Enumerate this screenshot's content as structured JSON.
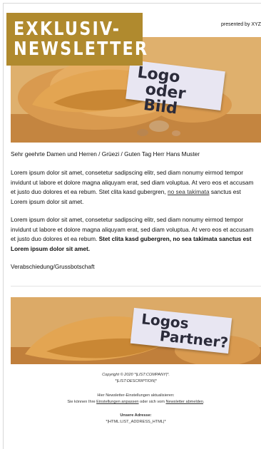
{
  "badge": {
    "line1": "EXKLUSIV-",
    "line2": "NEWSLETTER"
  },
  "header": {
    "presented_by": "presented by XYZ"
  },
  "hero": {
    "label_line1": "Logo",
    "label_line2": "oder Bild"
  },
  "body": {
    "greeting": "Sehr geehrte Damen und Herren / Grüezi / Guten Tag Herr Hans Muster",
    "p1_text": "Lorem ipsum dolor sit amet, consetetur sadipscing elitr, sed diam nonumy eirmod tempor invidunt ut labore et dolore magna aliquyam erat, sed diam voluptua. At vero eos et accusam et justo duo dolores et ea rebum. Stet clita kasd gubergren, ",
    "p1_link": "no sea takimata",
    "p1_end": " sanctus est Lorem ipsum dolor sit amet.",
    "p2_text": "Lorem ipsum dolor sit amet, consetetur sadipscing elitr, sed diam nonumy eirmod tempor invidunt ut labore et dolore magna aliquyam erat, sed diam voluptua. At vero eos et accusam et justo duo dolores et ea rebum. ",
    "p2_bold": "Stet clita kasd gubergren, no sea takimata sanctus est Lorem ipsum dolor sit amet.",
    "closing": "Verabschiedung/Grussbotschaft"
  },
  "partner": {
    "label_line1": "Logos",
    "label_line2": "Partner?"
  },
  "footer": {
    "copyright": "Copyright © 2020 *|LIST:COMPANY|*.",
    "description": "*|LIST:DESCRIPTION|*",
    "update_title": "Hier Newsletter-Einstellungen aktualisieren:",
    "update_prefix": "Sie können Ihre ",
    "update_link": "Einstellungen anpassen",
    "update_middle": " oder sich vom ",
    "unsubscribe_link": "Newsletter abmelden",
    "update_suffix": ".",
    "address_title": "Unsere Adresse:",
    "address_value": "*|HTML:LIST_ADDRESS_HTML|*"
  }
}
